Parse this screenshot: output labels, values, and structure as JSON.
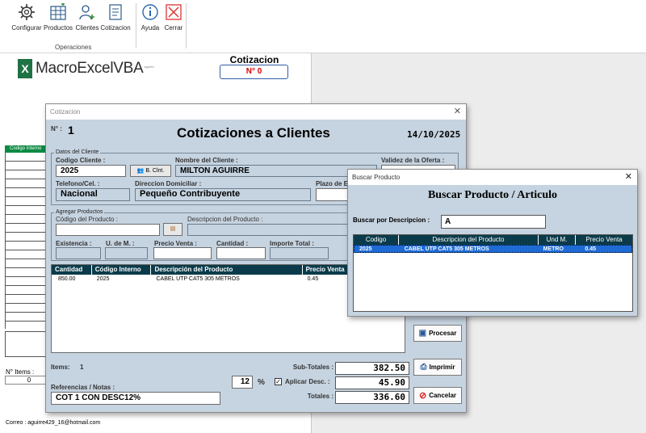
{
  "ribbon": {
    "buttons": [
      {
        "label": "Configurar",
        "icon": "gear-icon"
      },
      {
        "label": "Productos",
        "icon": "grid-icon"
      },
      {
        "label": "Clientes",
        "icon": "user-add-icon"
      },
      {
        "label": "Cotizacion",
        "icon": "document-icon"
      },
      {
        "label": "Ayuda",
        "icon": "info-icon"
      },
      {
        "label": "Cerrar",
        "icon": "close-icon"
      }
    ],
    "group_label": "Operaciones"
  },
  "sheet": {
    "logo_text": "MacroExcelVBA",
    "logo_superscript": "aguirre",
    "title": "Cotizacion",
    "number": "N° 0",
    "column_header": "Codigo Interno",
    "items_label": "N° Items :",
    "items_value": "0",
    "email": "Correo : aguirre429_16@hotmail.com"
  },
  "quote_dialog": {
    "window_title": "Cotizacion",
    "number_label": "N° :",
    "number_value": "1",
    "title": "Cotizaciones a Clientes",
    "date": "14/10/2025",
    "client_frame_label": "Datos del Cliente",
    "codigo_cliente_label": "Codigo Cliente :",
    "codigo_cliente_value": "2025",
    "buscar_cliente_button": "B. Clnt.",
    "nombre_cliente_label": "Nombre del Cliente :",
    "nombre_cliente_value": "MILTON AGUIRRE",
    "validez_label": "Validez de la Oferta :",
    "telefono_label": "Telefono/Cel. :",
    "telefono_value": "Nacional",
    "direccion_label": "Direccion Domiciliar :",
    "direccion_value": "Pequeño Contribuyente",
    "plazo_label": "Plazo de E",
    "products_frame_label": "Agregar Productos",
    "codigo_producto_label": "Código del Producto :",
    "descripcion_producto_label": "Descripcion del Producto :",
    "existencia_label": "Existencia :",
    "unidad_label": "U. de M. :",
    "precio_venta_label": "Precio Venta :",
    "cantidad_label": "Cantidad :",
    "importe_label": "Importe Total :",
    "grid_headers": [
      "Cantidad",
      "Código Interno",
      "Descripción del Producto",
      "Precio Venta"
    ],
    "grid_rows": [
      [
        "850.00",
        "2025",
        "CABEL UTP CAT5 305 METROS",
        "0.45"
      ]
    ],
    "procesar_button": "Procesar",
    "imprimir_button": "Imprimir",
    "cancelar_button": "Cancelar",
    "items_label": "Items:",
    "items_value": "1",
    "subtotal_label": "Sub-Totales :",
    "subtotal_value": "382.50",
    "discount_value": "12",
    "percent_sign": "%",
    "aplicar_label": "Aplicar Desc. :",
    "aplicar_checked": true,
    "discount_amount": "45.90",
    "total_label": "Totales :",
    "total_value": "336.60",
    "referencias_label": "Referencias  /  Notas :",
    "referencias_value": "COT 1 CON DESC12%"
  },
  "search_dialog": {
    "window_title": "Buscar Producto",
    "title": "Buscar Producto / Articulo",
    "search_label": "Buscar por Descripcion :",
    "search_value": "A",
    "headers": [
      "Codigo",
      "Descripcion del Producto",
      "Und M.",
      "Precio Venta"
    ],
    "rows": [
      [
        "2025",
        "CABEL UTP CAT5 305 METROS",
        "METRO",
        "0.45"
      ]
    ]
  }
}
